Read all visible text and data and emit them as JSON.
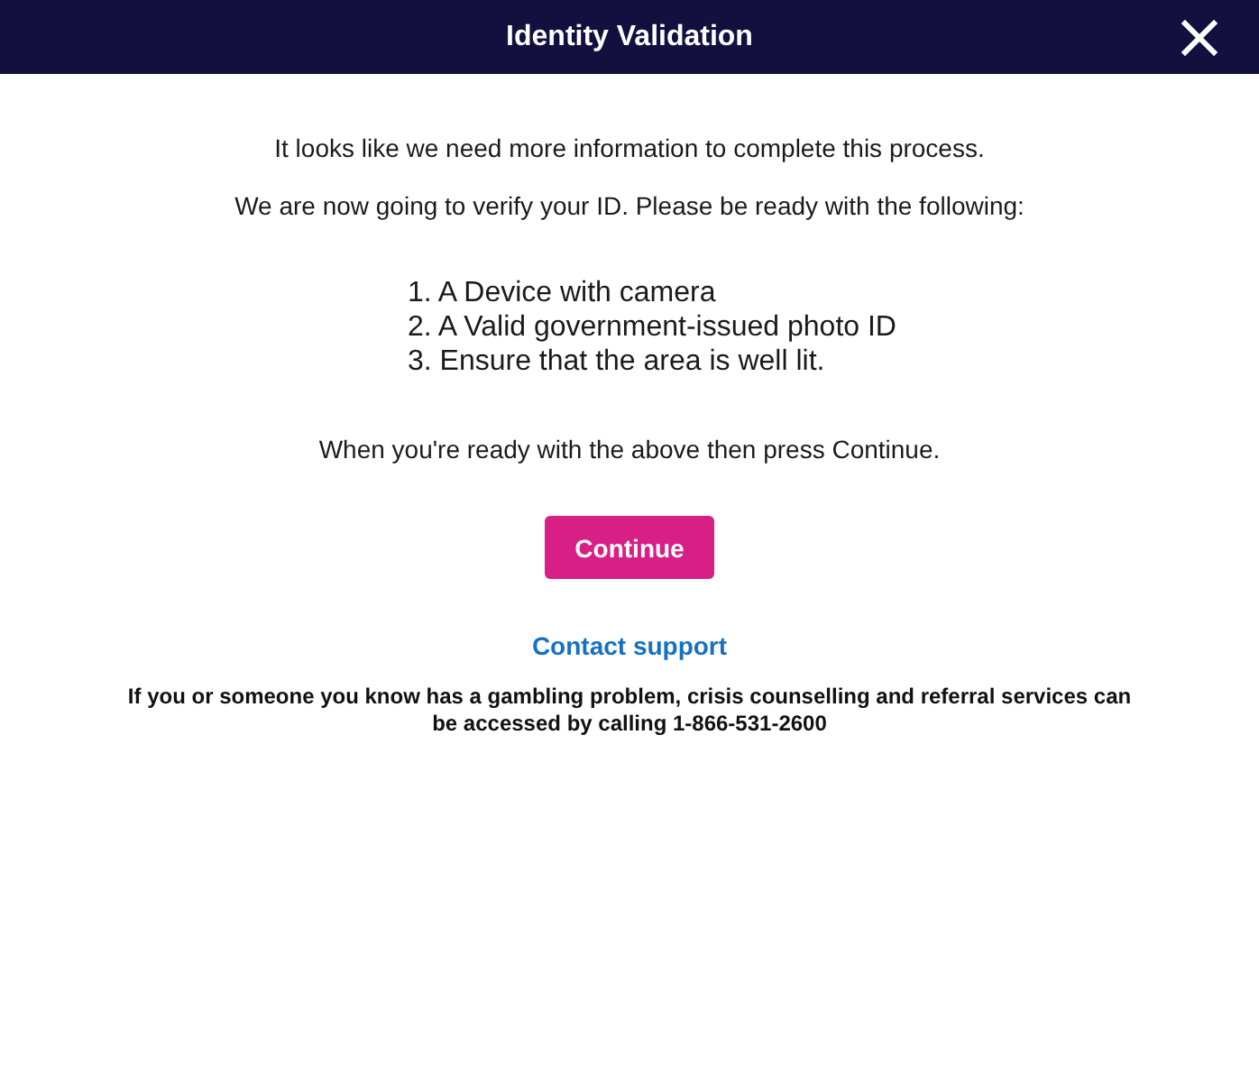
{
  "dialog": {
    "title": "Identity Validation"
  },
  "intro": [
    "It looks like we need more information to complete this process.",
    "We are now going to verify your ID. Please be ready with the following:"
  ],
  "requirements": [
    "1. A Device with camera",
    "2. A Valid government-issued photo ID",
    "3. Ensure that the area is well lit."
  ],
  "instruction": "When you're ready with the above then press Continue.",
  "continue_button": "Continue",
  "support_link": "Contact support",
  "disclaimer": "If you or someone you know has a gambling problem, crisis counselling and referral services can be accessed by calling 1-866-531-2600"
}
